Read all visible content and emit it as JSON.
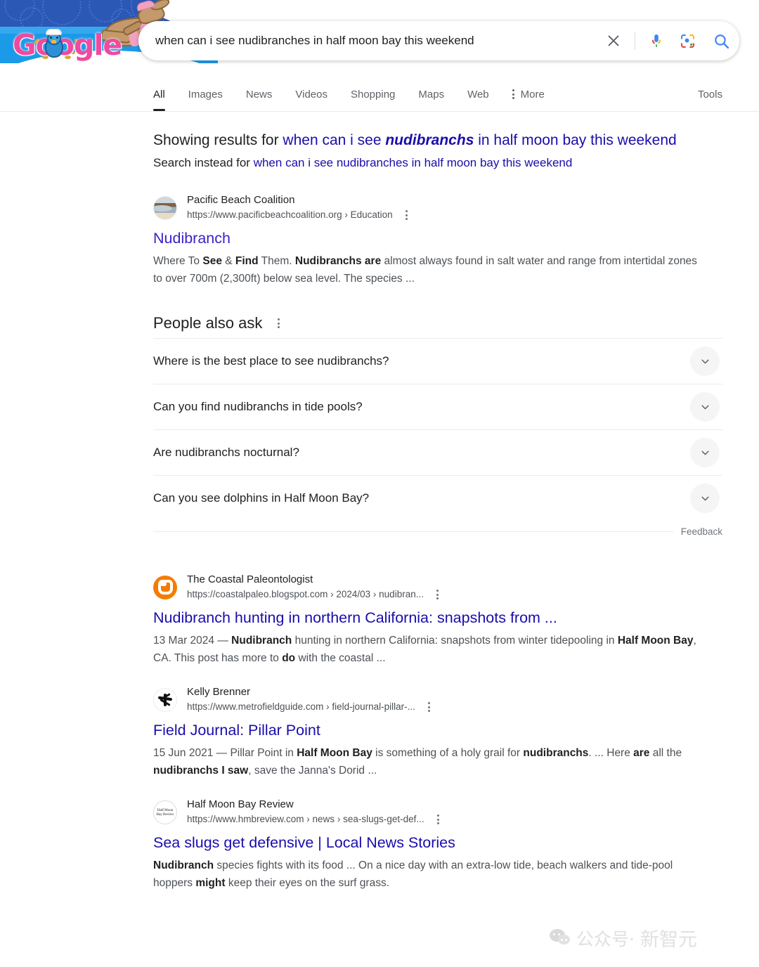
{
  "doodle": {
    "logo_text": "Google",
    "alt": "olympics-doodle"
  },
  "search": {
    "query": "when can i see nudibranches in half moon bay this weekend",
    "placeholder": "Search",
    "clear_icon": "close-icon",
    "mic_icon": "microphone-icon",
    "lens_icon": "google-lens-icon",
    "search_icon": "search-icon"
  },
  "tabs": {
    "items": [
      {
        "label": "All",
        "active": true
      },
      {
        "label": "Images",
        "active": false
      },
      {
        "label": "News",
        "active": false
      },
      {
        "label": "Videos",
        "active": false
      },
      {
        "label": "Shopping",
        "active": false
      },
      {
        "label": "Maps",
        "active": false
      },
      {
        "label": "Web",
        "active": false
      }
    ],
    "more_label": "More",
    "tools_label": "Tools"
  },
  "spelling": {
    "showing_prefix": "Showing results for ",
    "corrected_before": "when can i see ",
    "corrected_bold": "nudibranchs",
    "corrected_after": " in half moon bay this weekend",
    "instead_prefix": "Search instead for ",
    "instead_query": "when can i see nudibranches in half moon bay this weekend"
  },
  "results": [
    {
      "site": "Pacific Beach Coalition",
      "url": "https://www.pacificbeachcoalition.org › Education",
      "title": "Nudibranch",
      "visited": true,
      "snippet_parts": [
        {
          "t": "Where To ",
          "b": false
        },
        {
          "t": "See",
          "b": true
        },
        {
          "t": " & ",
          "b": false
        },
        {
          "t": "Find",
          "b": true
        },
        {
          "t": " Them. ",
          "b": false
        },
        {
          "t": "Nudibranchs are",
          "b": true
        },
        {
          "t": " almost always found in salt water and range from intertidal zones to over 700m (2,300ft) below sea level. The species ...",
          "b": false
        }
      ]
    },
    {
      "site": "The Coastal Paleontologist",
      "url": "https://coastalpaleo.blogspot.com › 2024/03 › nudibran...",
      "title": "Nudibranch hunting in northern California: snapshots from ...",
      "visited": false,
      "snippet_parts": [
        {
          "t": "13 Mar 2024 — ",
          "b": false
        },
        {
          "t": "Nudibranch",
          "b": true
        },
        {
          "t": " hunting in northern California: snapshots from winter tidepooling in ",
          "b": false
        },
        {
          "t": "Half Moon Bay",
          "b": true
        },
        {
          "t": ", CA. This post has more to ",
          "b": false
        },
        {
          "t": "do",
          "b": true
        },
        {
          "t": " with the coastal ...",
          "b": false
        }
      ]
    },
    {
      "site": "Kelly Brenner",
      "url": "https://www.metrofieldguide.com › field-journal-pillar-...",
      "title": "Field Journal: Pillar Point",
      "visited": false,
      "snippet_parts": [
        {
          "t": "15 Jun 2021 — Pillar Point in ",
          "b": false
        },
        {
          "t": "Half Moon Bay",
          "b": true
        },
        {
          "t": " is something of a holy grail for ",
          "b": false
        },
        {
          "t": "nudibranchs",
          "b": true
        },
        {
          "t": ". ... Here ",
          "b": false
        },
        {
          "t": "are",
          "b": true
        },
        {
          "t": " all the ",
          "b": false
        },
        {
          "t": "nudibranchs I saw",
          "b": true
        },
        {
          "t": ", save the Janna's Dorid ...",
          "b": false
        }
      ]
    },
    {
      "site": "Half Moon Bay Review",
      "url": "https://www.hmbreview.com › news › sea-slugs-get-def...",
      "title": "Sea slugs get defensive | Local News Stories",
      "visited": false,
      "snippet_parts": [
        {
          "t": "Nudibranch",
          "b": true
        },
        {
          "t": " species fights with its food ... On a nice day with an extra-low tide, beach walkers and tide-pool hoppers ",
          "b": false
        },
        {
          "t": "might",
          "b": true
        },
        {
          "t": " keep their eyes on the surf grass.",
          "b": false
        }
      ]
    }
  ],
  "people_also_ask": {
    "title": "People also ask",
    "questions": [
      "Where is the best place to see nudibranchs?",
      "Can you find nudibranchs in tide pools?",
      "Are nudibranchs nocturnal?",
      "Can you see dolphins in Half Moon Bay?"
    ],
    "feedback_label": "Feedback"
  },
  "favicon_hmb_lines": [
    "Half Moon",
    "Bay Review"
  ],
  "watermark": {
    "account": "公众号·",
    "name": "新智元"
  },
  "colors": {
    "link": "#1a0dab",
    "visited_link": "#3b22c9",
    "text": "#202124",
    "muted": "#4d5156"
  }
}
